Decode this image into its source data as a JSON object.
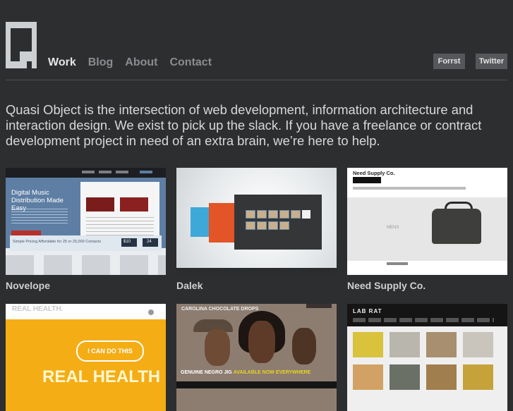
{
  "nav": [
    "Work",
    "Blog",
    "About",
    "Contact"
  ],
  "social": {
    "forrst": "Forrst",
    "twitter": "Twitter"
  },
  "intro": "Quasi Object is the intersection of web development, information architecture and interaction design. We exist to pick up the slack. If you have a freelance or contract development project in need of an extra brain, we’re here to help.",
  "projects": [
    {
      "name": "Novelope"
    },
    {
      "name": "Dalek"
    },
    {
      "name": "Need Supply Co."
    }
  ],
  "thumbs": {
    "novelope_hero": "Digital Music Distribution Made Easy",
    "novelope_band": "Simple Pricing Affordable for 25 or 25,000 Contacts",
    "novelope_price1": "$10",
    "novelope_price2": "24",
    "need_logo": "Need Supply Co.",
    "need_label": "MENS",
    "realhealth_header": "REAL HEALTH.",
    "realhealth_bubble": "I CAN DO THIS",
    "realhealth_big": "REAL HEALTH",
    "ccd_title": "CAROLINA CHOCOLATE DROPS",
    "ccd_banner_a": "GENUINE NEGRO JIG",
    "ccd_banner_b": "AVAILABLE NOW EVERYWHERE",
    "labrat_logo": "LAB RAT"
  },
  "colors": {
    "background": "#2d2e30",
    "nav_active": "#e6e6e6",
    "nav_inactive": "#8a8c8f",
    "button": "#55575a"
  }
}
